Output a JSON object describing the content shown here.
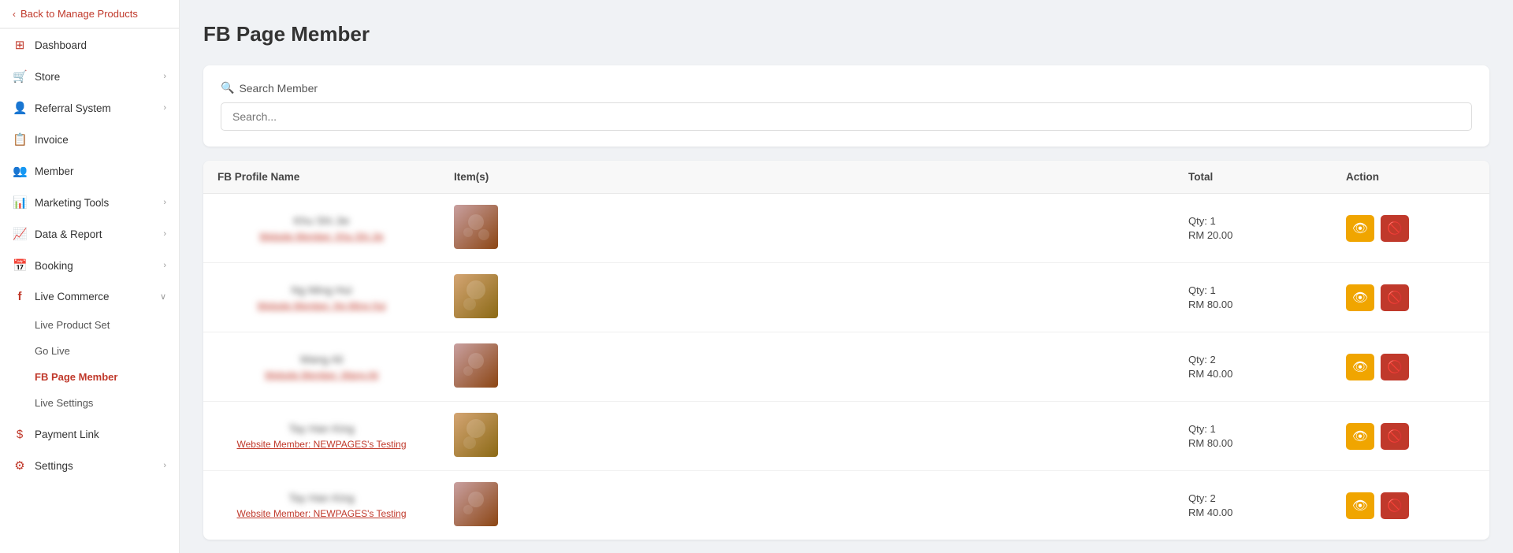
{
  "sidebar": {
    "back_label": "Back to Manage Products",
    "items": [
      {
        "id": "dashboard",
        "label": "Dashboard",
        "icon": "⊞",
        "has_arrow": false
      },
      {
        "id": "store",
        "label": "Store",
        "icon": "🛒",
        "has_arrow": true
      },
      {
        "id": "referral",
        "label": "Referral System",
        "icon": "👤",
        "has_arrow": true
      },
      {
        "id": "invoice",
        "label": "Invoice",
        "icon": "📋",
        "has_arrow": false
      },
      {
        "id": "member",
        "label": "Member",
        "icon": "👥",
        "has_arrow": false
      },
      {
        "id": "marketing",
        "label": "Marketing Tools",
        "icon": "📊",
        "has_arrow": true
      },
      {
        "id": "data",
        "label": "Data & Report",
        "icon": "📈",
        "has_arrow": true
      },
      {
        "id": "booking",
        "label": "Booking",
        "icon": "📅",
        "has_arrow": true
      },
      {
        "id": "live_commerce",
        "label": "Live Commerce",
        "icon": "f",
        "has_arrow": false,
        "expanded": true
      }
    ],
    "sub_items": [
      {
        "id": "live_product_set",
        "label": "Live Product Set",
        "active": false
      },
      {
        "id": "go_live",
        "label": "Go Live",
        "active": false
      },
      {
        "id": "fb_page_member",
        "label": "FB Page Member",
        "active": true
      },
      {
        "id": "live_settings",
        "label": "Live Settings",
        "active": false
      }
    ],
    "bottom_items": [
      {
        "id": "payment_link",
        "label": "Payment Link",
        "icon": "$",
        "has_arrow": false
      },
      {
        "id": "settings",
        "label": "Settings",
        "icon": "⚙",
        "has_arrow": true
      }
    ]
  },
  "page": {
    "title": "FB Page Member",
    "search_label": "Search Member",
    "search_placeholder": "Search..."
  },
  "table": {
    "columns": [
      "FB Profile Name",
      "Item(s)",
      "Total",
      "Action"
    ],
    "rows": [
      {
        "name": "Khu Shi Jie",
        "member_label": "Website Member:",
        "member_name": "Khu Shi Jie",
        "thumb_class": "thumb-1",
        "qty": "Qty: 1",
        "total": "RM 20.00"
      },
      {
        "name": "Ng Ming Hui",
        "member_label": "Website Member:",
        "member_name": "Ng Ming Hui",
        "thumb_class": "thumb-2",
        "qty": "Qty: 1",
        "total": "RM 80.00"
      },
      {
        "name": "Wang Ali",
        "member_label": "Website Member:",
        "member_name": "Wang Ali",
        "thumb_class": "thumb-3",
        "qty": "Qty: 2",
        "total": "RM 40.00"
      },
      {
        "name": "Tay Han King",
        "member_label": "Website Member:",
        "member_name": "NEWPAGES's Testing",
        "thumb_class": "thumb-4",
        "qty": "Qty: 1",
        "total": "RM 80.00"
      },
      {
        "name": "Tay Han King",
        "member_label": "Website Member:",
        "member_name": "NEWPAGES's Testing",
        "thumb_class": "thumb-5",
        "qty": "Qty: 2",
        "total": "RM 40.00"
      }
    ],
    "btn_view_label": "👁",
    "btn_cancel_label": "🚫"
  },
  "colors": {
    "accent": "#c0392b",
    "btn_view": "#f0a500",
    "btn_cancel": "#c0392b"
  }
}
